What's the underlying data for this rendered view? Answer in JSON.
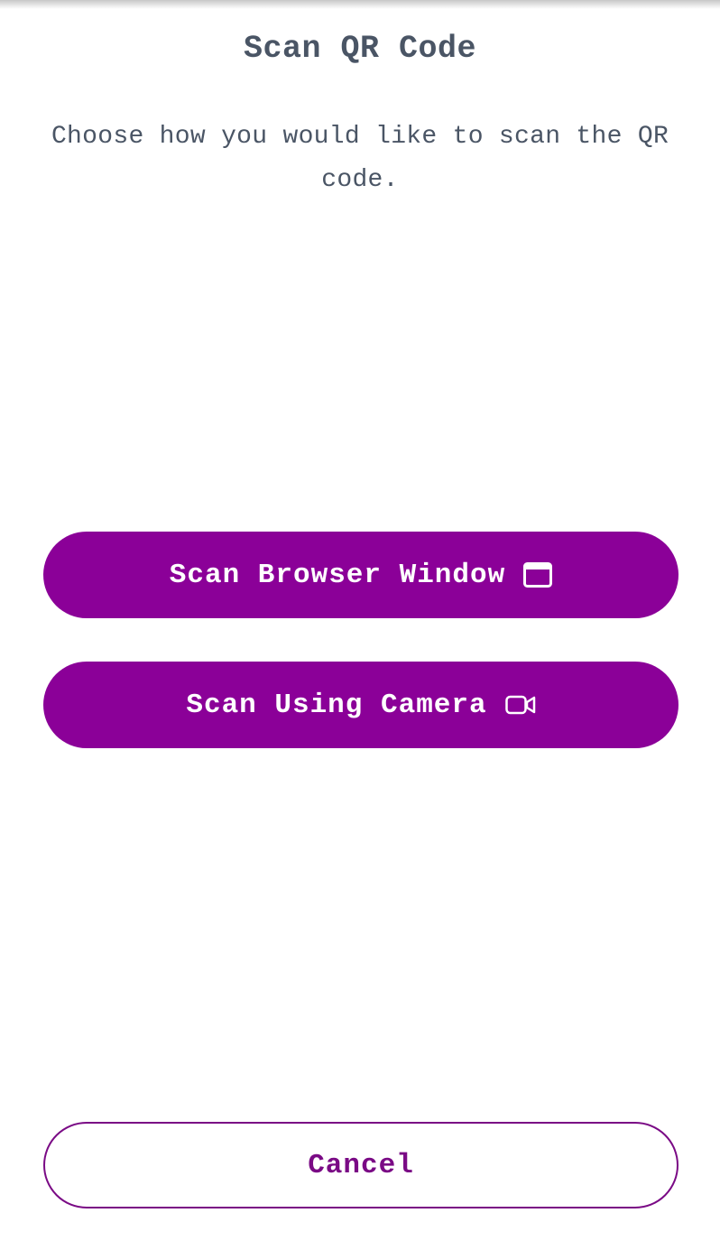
{
  "dialog": {
    "title": "Scan QR Code",
    "description": "Choose how you would like to scan the QR code."
  },
  "actions": {
    "scan_browser_label": "Scan Browser Window",
    "scan_browser_icon": "browser-window-icon",
    "scan_camera_label": "Scan Using Camera",
    "scan_camera_icon": "video-camera-icon",
    "cancel_label": "Cancel"
  },
  "colors": {
    "primary": "#8b0098",
    "text": "#4a5565",
    "cancel_border": "#7a0a85"
  }
}
